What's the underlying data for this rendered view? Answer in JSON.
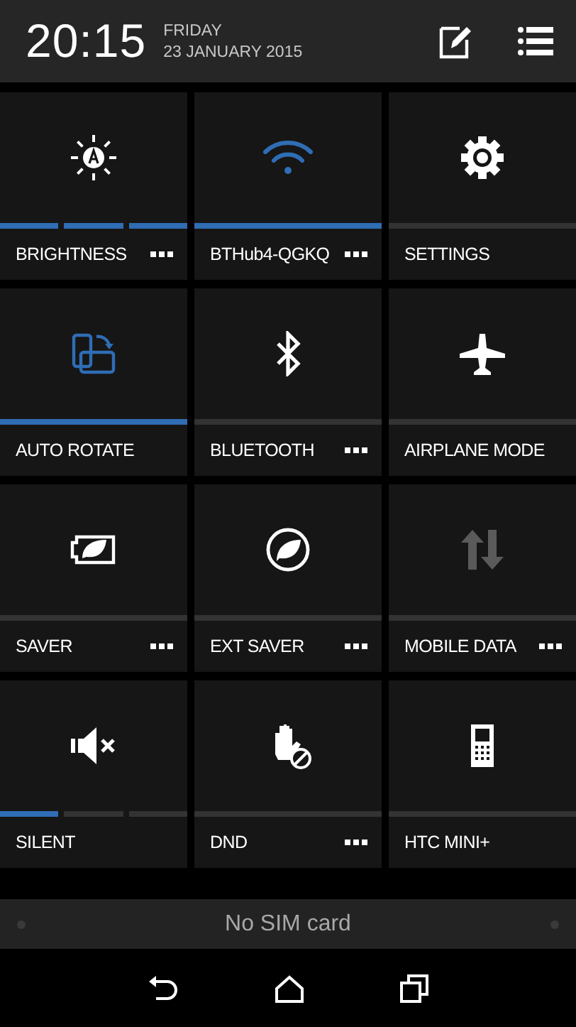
{
  "header": {
    "time": "20:15",
    "day": "FRIDAY",
    "date": "23 JANUARY 2015"
  },
  "tiles": [
    {
      "label": "BRIGHTNESS",
      "kind": "segmented",
      "segments": [
        {
          "on": true
        },
        {
          "on": true
        },
        {
          "on": true
        }
      ],
      "menu": true
    },
    {
      "label": "BTHub4-QGKQ",
      "kind": "toggle",
      "on": true,
      "menu": true
    },
    {
      "label": "SETTINGS",
      "kind": "toggle",
      "on": false,
      "menu": false
    },
    {
      "label": "AUTO ROTATE",
      "kind": "toggle",
      "on": true,
      "menu": false
    },
    {
      "label": "BLUETOOTH",
      "kind": "toggle",
      "on": false,
      "menu": true
    },
    {
      "label": "AIRPLANE MODE",
      "kind": "toggle",
      "on": false,
      "menu": false
    },
    {
      "label": "SAVER",
      "kind": "toggle",
      "on": false,
      "menu": true
    },
    {
      "label": "EXT SAVER",
      "kind": "toggle",
      "on": false,
      "menu": true
    },
    {
      "label": "MOBILE DATA",
      "kind": "toggle",
      "on": false,
      "disabled": true,
      "menu": true
    },
    {
      "label": "SILENT",
      "kind": "segmented",
      "segments": [
        {
          "on": true
        },
        {
          "on": false
        },
        {
          "on": false
        }
      ],
      "menu": false
    },
    {
      "label": "DND",
      "kind": "toggle",
      "on": false,
      "menu": true
    },
    {
      "label": "HTC MINI+",
      "kind": "toggle",
      "on": false,
      "menu": false
    }
  ],
  "carrier": {
    "text": "No SIM card"
  }
}
